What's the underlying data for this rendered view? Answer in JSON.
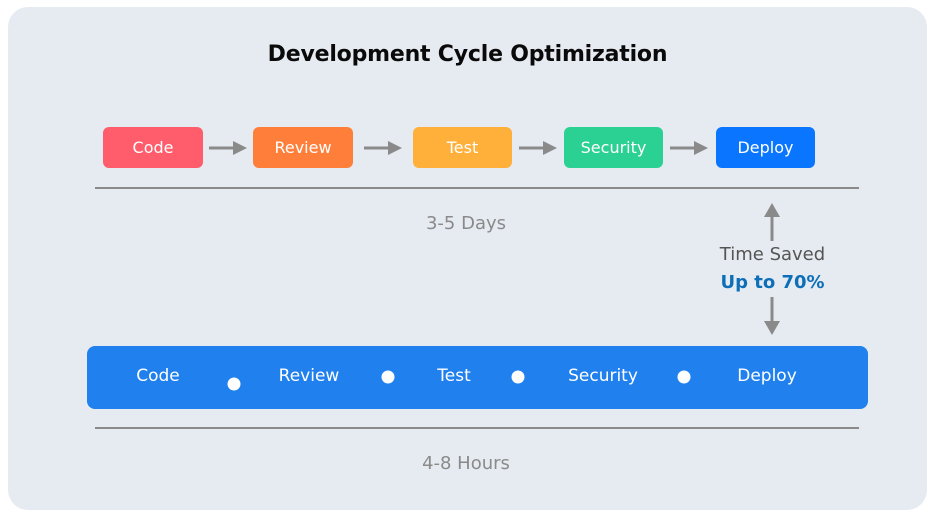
{
  "title": "Development Cycle Optimization",
  "traditional": {
    "steps": [
      {
        "label": "Code",
        "color": "#ff5c6c"
      },
      {
        "label": "Review",
        "color": "#ff7f3a"
      },
      {
        "label": "Test",
        "color": "#ffb03a"
      },
      {
        "label": "Security",
        "color": "#2bd192"
      },
      {
        "label": "Deploy",
        "color": "#0a76ff"
      }
    ],
    "duration": "3-5 Days"
  },
  "savings": {
    "label": "Time Saved",
    "value": "Up to 70%"
  },
  "optimized": {
    "steps": [
      "Code",
      "Review",
      "Test",
      "Security",
      "Deploy"
    ],
    "color": "#1f80ee",
    "duration": "4-8 Hours"
  },
  "colors": {
    "background": "#e6eaf1",
    "arrow": "#8a8a8a",
    "divider": "#8a8a8a",
    "accent_text": "#0d6fb8"
  }
}
